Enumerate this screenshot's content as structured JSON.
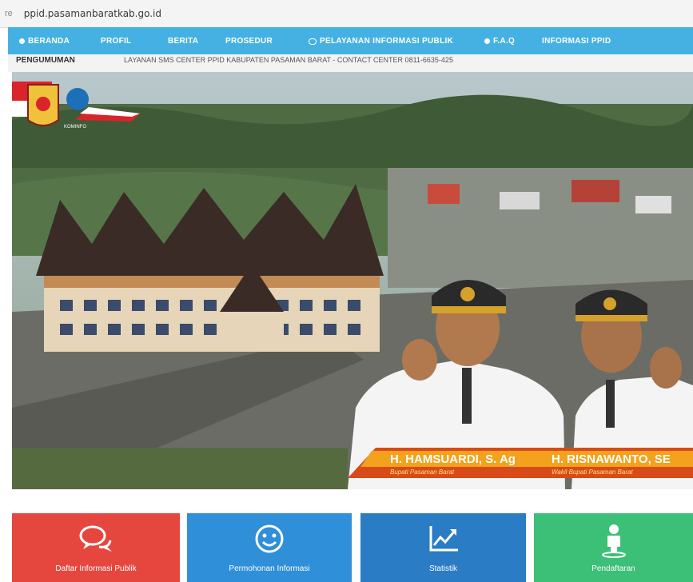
{
  "browser": {
    "prefix": "re",
    "url": "ppid.pasamanbaratkab.go.id"
  },
  "nav": {
    "items": [
      {
        "label": "BERANDA",
        "icon": "home-dot-icon"
      },
      {
        "label": "PROFIL"
      },
      {
        "label": "BERITA"
      },
      {
        "label": "PROSEDUR"
      },
      {
        "label": "PELAYANAN INFORMASI PUBLIK",
        "icon": "chat-icon"
      },
      {
        "label": "F.A.Q",
        "icon": "question-dot-icon"
      },
      {
        "label": "INFORMASI PPID"
      }
    ]
  },
  "announcement": {
    "label": "PENGUMUMAN",
    "text": "LAYANAN SMS CENTER PPID KABUPATEN PASAMAN BARAT - CONTACT CENTER 0811-6635-425"
  },
  "banner": {
    "logo_text": "KOMINFO",
    "person1": {
      "name": "H. HAMSUARDI, S. Ag",
      "title": "Bupati Pasaman Barat"
    },
    "person2": {
      "name": "H. RISNAWANTO, SE",
      "title": "Wakil Bupati Pasaman Barat"
    }
  },
  "tiles": [
    {
      "label": "Daftar Informasi Publik",
      "icon": "chat-bubbles-icon",
      "color": "#e5473f"
    },
    {
      "label": "Permohonan Informasi",
      "icon": "smiley-icon",
      "color": "#2f8fd8"
    },
    {
      "label": "Statistik",
      "icon": "chart-up-icon",
      "color": "#2a7cc5"
    },
    {
      "label": "Pendaftaran",
      "icon": "person-icon",
      "color": "#3cbf77"
    }
  ]
}
